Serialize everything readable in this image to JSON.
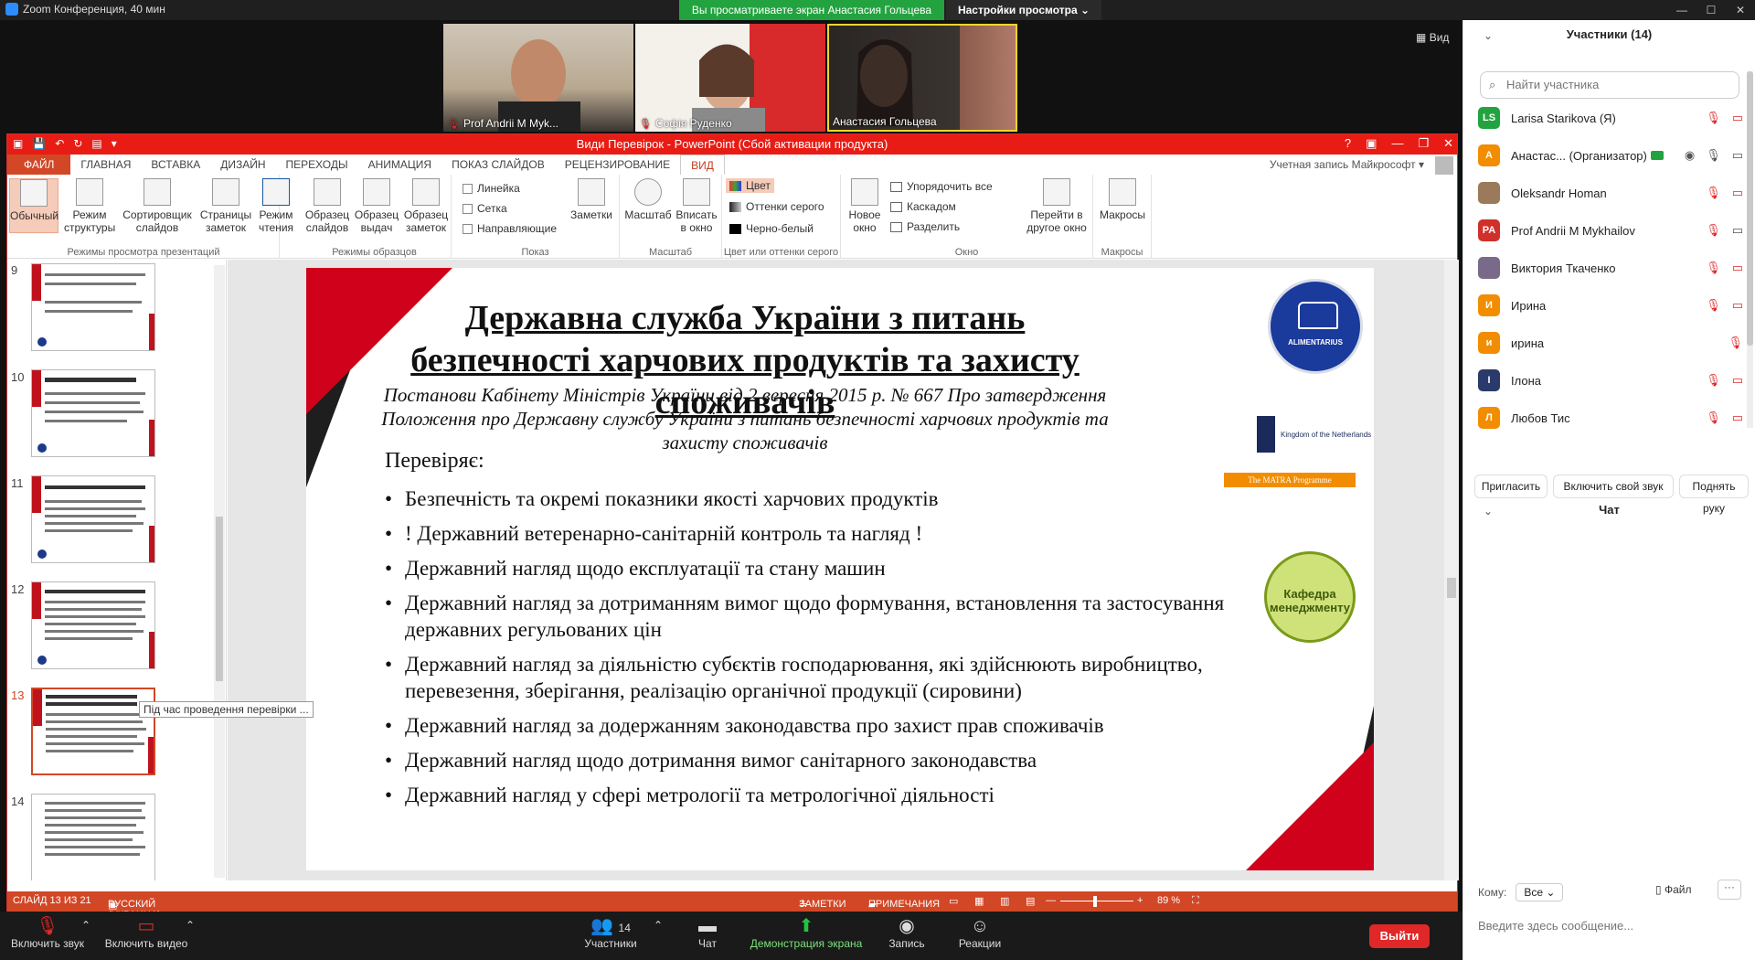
{
  "zoom": {
    "window_title": "Zoom Конференция, 40 мин",
    "viewing_banner": "Вы просматриваете экран Анастасия Гольцева",
    "view_settings": "Настройки просмотра",
    "view_button": "Вид",
    "videos": [
      {
        "name": "Prof Andrii M Myk..."
      },
      {
        "name": "Софія Руденко"
      },
      {
        "name": "Анастасия Гольцева"
      }
    ]
  },
  "ppt": {
    "title": "Види Перевірок - PowerPoint (Сбой активации продукта)",
    "account": "Учетная запись Майкрософт",
    "tabs": [
      "ФАЙЛ",
      "ГЛАВНАЯ",
      "ВСТАВКА",
      "ДИЗАЙН",
      "ПЕРЕХОДЫ",
      "АНИМАЦИЯ",
      "ПОКАЗ СЛАЙДОВ",
      "РЕЦЕНЗИРОВАНИЕ",
      "ВИД"
    ],
    "ribbon": {
      "views_group": "Режимы просмотра презентаций",
      "normal": "Обычный",
      "outline": [
        "Режим",
        "структуры"
      ],
      "sorter": [
        "Сортировщик",
        "слайдов"
      ],
      "notes_page": [
        "Страницы",
        "заметок"
      ],
      "reading": [
        "Режим",
        "чтения"
      ],
      "masters_group": "Режимы образцов",
      "slide_master": [
        "Образец",
        "слайдов"
      ],
      "handout_master": [
        "Образец",
        "выдач"
      ],
      "notes_master": [
        "Образец",
        "заметок"
      ],
      "show_group": "Показ",
      "ruler": "Линейка",
      "grid": "Сетка",
      "guides": "Направляющие",
      "notes": "Заметки",
      "zoom_group": "Масштаб",
      "zoom": "Масштаб",
      "fit": [
        "Вписать",
        "в окно"
      ],
      "color_group": "Цвет или оттенки серого",
      "color": "Цвет",
      "grayscale": "Оттенки серого",
      "bw": "Черно-белый",
      "window_group": "Окно",
      "new_window": [
        "Новое",
        "окно"
      ],
      "arrange_all": "Упорядочить все",
      "cascade": "Каскадом",
      "split": "Разделить",
      "switch": [
        "Перейти в",
        "другое окно"
      ],
      "macros_group": "Макросы",
      "macros": "Макросы"
    },
    "thumbs": [
      {
        "num": "9"
      },
      {
        "num": "10"
      },
      {
        "num": "11"
      },
      {
        "num": "12"
      },
      {
        "num": "13"
      },
      {
        "num": "14"
      }
    ],
    "tooltip": "Під час проведення перевірки ...",
    "slide": {
      "title": "Державна служба України з питань безпечності харчових продуктів та захисту споживачів",
      "subtitle": "Постанови Кабінету Міністрів України від 2 вересня 2015 р. № 667 Про затвердження Положення про Державну службу України з питань безпечності харчових продуктів та захисту споживачів",
      "lead": "Перевіряє:",
      "items": [
        "Безпечність та окремі показники якості харчових продуктів",
        "! Державний ветеренарно-санітарній контроль та нагляд !",
        "Державний нагляд щодо експлуатації та стану машин",
        "Державний нагляд за дотриманням вимог щодо формування, встановлення та застосування державних регульованих цін",
        "Державний нагляд за діяльністю субєктів господарювання, які здійснюють виробництво, перевезення, зберігання, реалізацію органічної продукції (сировини)",
        "Державний нагляд за додержанням законодавства про захист прав споживачів",
        "Державний нагляд щодо дотримання вимог санітарного законодавства",
        "Державний нагляд у сфері метрології та метрологічної діяльності"
      ],
      "seal_text": "ALIMENTARIUS",
      "nl_text": "Kingdom of the Netherlands",
      "matra": "The MATRA Programme",
      "green_text": "Кафедра менеджменту"
    },
    "status": {
      "slide": "СЛАЙД 13 ИЗ 21",
      "lang": "РУССКИЙ (УКРАИНА)",
      "notes": "ЗАМЕТКИ",
      "comments": "ПРИМЕЧАНИЯ",
      "zoom": "89 %"
    }
  },
  "panel": {
    "participants_title": "Участники (14)",
    "search_placeholder": "Найти участника",
    "participants": [
      {
        "initials": "LS",
        "name": "Larisa Starikova (Я)",
        "color": "#23a33f"
      },
      {
        "initials": "A",
        "name": "Анастас... (Организатор)",
        "color": "#f28c00"
      },
      {
        "initials": "",
        "name": "Oleksandr Homan",
        "color": "#9a7a5a"
      },
      {
        "initials": "PA",
        "name": "Prof Andrii M Mykhailov",
        "color": "#d0302a"
      },
      {
        "initials": "",
        "name": "Виктория Ткаченко",
        "color": "#7a6a8a"
      },
      {
        "initials": "И",
        "name": "Ирина",
        "color": "#f28c00"
      },
      {
        "initials": "и",
        "name": "ирина",
        "color": "#f28c00"
      },
      {
        "initials": "I",
        "name": "Ілона",
        "color": "#2a3a6a"
      },
      {
        "initials": "Л",
        "name": "Любов Тис",
        "color": "#f28c00"
      }
    ],
    "invite": "Пригласить",
    "unmute": "Включить свой звук",
    "raise_hand": "Поднять руку",
    "chat_title": "Чат",
    "to_label": "Кому:",
    "to_value": "Все",
    "file_label": "Файл",
    "chat_placeholder": "Введите здесь сообщение..."
  },
  "toolbar": {
    "audio": "Включить звук",
    "video": "Включить видео",
    "participants": "Участники",
    "participants_count": "14",
    "chat": "Чат",
    "share": "Демонстрация экрана",
    "record": "Запись",
    "reactions": "Реакции",
    "leave": "Выйти"
  }
}
